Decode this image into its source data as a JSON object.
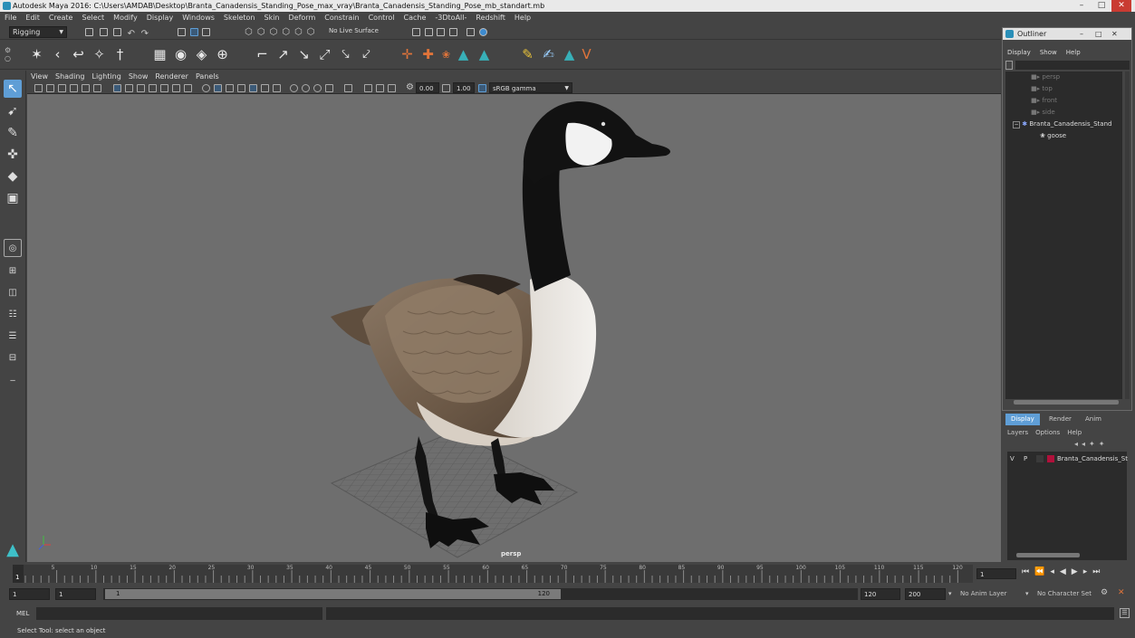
{
  "window": {
    "title": "Autodesk Maya 2016: C:\\Users\\AMDAB\\Desktop\\Branta_Canadensis_Standing_Pose_max_vray\\Branta_Canadensis_Standing_Pose_mb_standart.mb"
  },
  "menubar": [
    "File",
    "Edit",
    "Create",
    "Select",
    "Modify",
    "Display",
    "Windows",
    "Skeleton",
    "Skin",
    "Deform",
    "Constrain",
    "Control",
    "Cache",
    "-3DtoAll-",
    "Redshift",
    "Help"
  ],
  "shelf": {
    "mode": "Rigging",
    "live_surface": "No Live Surface"
  },
  "viewport": {
    "menu": [
      "View",
      "Shading",
      "Lighting",
      "Show",
      "Renderer",
      "Panels"
    ],
    "exposure": "0.00",
    "gamma": "1.00",
    "color_space": "sRGB gamma",
    "camera_label": "persp"
  },
  "outliner": {
    "title": "Outliner",
    "menu": [
      "Display",
      "Show",
      "Help"
    ],
    "items": [
      {
        "label": "persp",
        "indent": 2
      },
      {
        "label": "top",
        "indent": 2
      },
      {
        "label": "front",
        "indent": 2
      },
      {
        "label": "side",
        "indent": 2
      },
      {
        "label": "Branta_Canadensis_Stand",
        "indent": 1
      },
      {
        "label": "goose",
        "indent": 3
      }
    ]
  },
  "layer_panel": {
    "tabs": [
      "Display",
      "Render",
      "Anim"
    ],
    "menu": [
      "Layers",
      "Options",
      "Help"
    ],
    "layer": {
      "v": "V",
      "p": "P",
      "name": "Branta_Canadensis_St",
      "color": "#b0103a"
    }
  },
  "timeline": {
    "ticks": [
      "5",
      "10",
      "15",
      "20",
      "25",
      "30",
      "35",
      "40",
      "45",
      "50",
      "55",
      "60",
      "65",
      "70",
      "75",
      "80",
      "85",
      "90",
      "95",
      "100",
      "105",
      "110",
      "115",
      "120"
    ],
    "current_frame_left": "1",
    "current_frame": "1"
  },
  "range": {
    "start": "1",
    "start2": "1",
    "inner_start": "1",
    "inner_end": "120",
    "end": "120",
    "end2": "200",
    "anim_layer": "No Anim Layer",
    "character_set": "No Character Set"
  },
  "command": {
    "label": "MEL"
  },
  "helpline": "Select Tool: select an object",
  "colors": {
    "background": "#444444",
    "viewport": "#6e6e6e",
    "field": "#2b2b2b",
    "accent": "#5f9ed6"
  }
}
